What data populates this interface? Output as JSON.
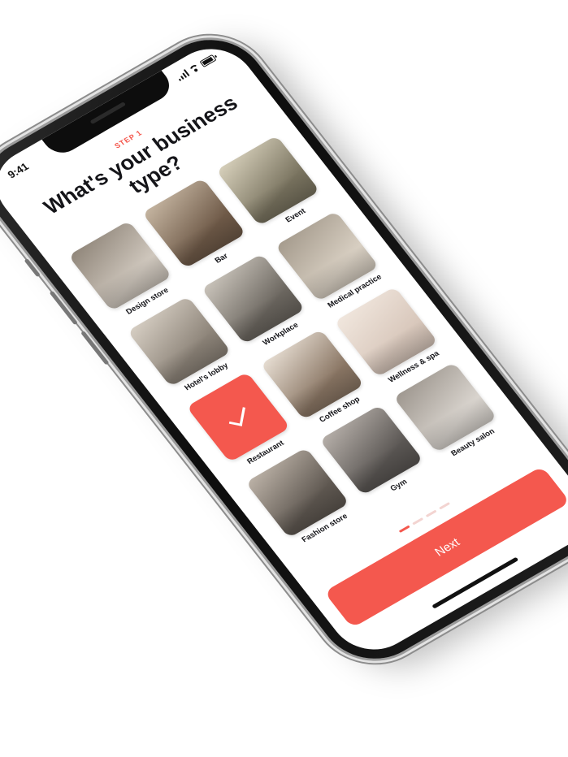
{
  "status_bar": {
    "time": "9:41"
  },
  "header": {
    "step": "STEP 1",
    "title": "What's your business type?"
  },
  "business_types": [
    {
      "label": "Design store",
      "icon": "sofa-photo",
      "color": "#cfc7bd",
      "accent": "#8f8579"
    },
    {
      "label": "Bar",
      "icon": "shelves-photo",
      "color": "#6f5a48",
      "accent": "#c6b6a2"
    },
    {
      "label": "Event",
      "icon": "crowd-photo",
      "color": "#7a7460",
      "accent": "#d8d1bc"
    },
    {
      "label": "Hotel's lobby",
      "icon": "lobby-photo",
      "color": "#8d8479",
      "accent": "#d7cfc4"
    },
    {
      "label": "Workplace",
      "icon": "office-photo",
      "color": "#6c6760",
      "accent": "#cbc5bc"
    },
    {
      "label": "Medical practice",
      "icon": "corridor-photo",
      "color": "#d8cfc2",
      "accent": "#a49a8c"
    },
    {
      "label": "Restaurant",
      "icon": "check-icon",
      "color": "#f4584e",
      "accent": "#f4584e",
      "selected": true
    },
    {
      "label": "Coffee shop",
      "icon": "coffee-photo",
      "color": "#8a7664",
      "accent": "#e8dfd4"
    },
    {
      "label": "Wellness & spa",
      "icon": "spa-photo",
      "color": "#d8c7bb",
      "accent": "#f1e7de"
    },
    {
      "label": "Fashion store",
      "icon": "clothes-rack-photo",
      "color": "#5f5851",
      "accent": "#bdb3a8"
    },
    {
      "label": "Gym",
      "icon": "gym-photo",
      "color": "#5b5754",
      "accent": "#b7b0aa"
    },
    {
      "label": "Beauty salon",
      "icon": "salon-photo",
      "color": "#d9d4ce",
      "accent": "#9d968e"
    }
  ],
  "pager": {
    "total": 4,
    "active": 0
  },
  "footer": {
    "next_label": "Next"
  },
  "colors": {
    "accent": "#f4584e",
    "text": "#151519"
  }
}
